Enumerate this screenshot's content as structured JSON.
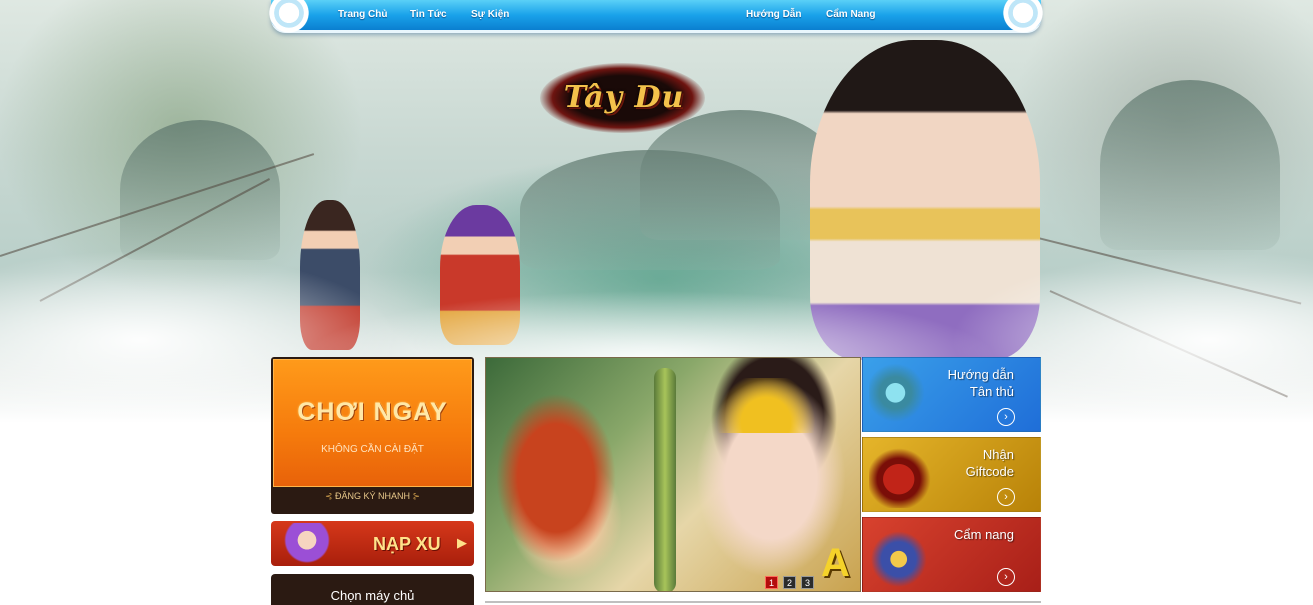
{
  "nav": {
    "items": [
      "Trang Chủ",
      "Tin Tức",
      "Sự Kiện",
      "Hướng Dẫn",
      "Cẩm Nang"
    ]
  },
  "logo": {
    "text": "Tây Du"
  },
  "left": {
    "play_now_title": "CHƠI NGAY",
    "play_now_sub": "KHÔNG CẦN CÀI ĐẶT",
    "register_label": "ĐĂNG KÝ NHANH",
    "topup_label": "NẠP XU",
    "server_label": "Chọn máy chủ"
  },
  "banner": {
    "letter": "A",
    "pages": [
      "1",
      "2",
      "3"
    ],
    "active_page": "1"
  },
  "cards": [
    {
      "title": "Hướng dẫn\nTân thủ",
      "icon": "jade-staff-icon",
      "color": "#2a86e0"
    },
    {
      "title": "Nhận\nGiftcode",
      "icon": "treasure-chest-icon",
      "color": "#d4a11c"
    },
    {
      "title": "Cẩm nang",
      "icon": "medallion-icon",
      "color": "#c23224"
    }
  ],
  "colors": {
    "nav_blue": "#1aa2ea",
    "play_orange": "#f57a0c",
    "topup_red": "#c22b14",
    "panel_dark": "#2b1a12"
  }
}
